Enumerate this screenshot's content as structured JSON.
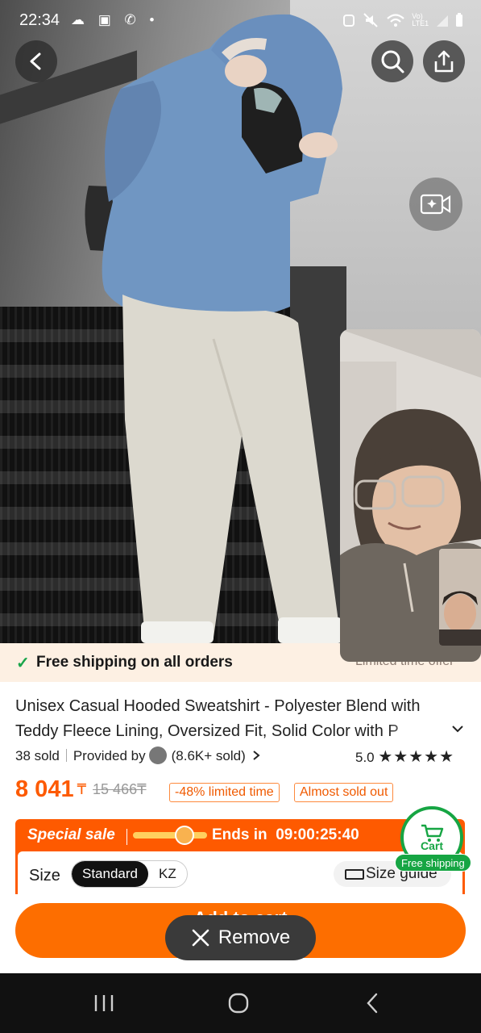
{
  "status_bar": {
    "time": "22:34",
    "left_icons": "☁ ▣ ✆ •",
    "right_icons": "⏰ 🔕 ᯤ Vo) LTE1 ▮",
    "vo_label": "Vo)",
    "lte_label": "LTE1"
  },
  "shipping": {
    "text": "Free shipping on all orders",
    "limited": "Limited time offer"
  },
  "product": {
    "title": "Unisex Casual Hooded Sweatshirt - Polyester Blend with Teddy Fleece Lining, Oversized Fit, Solid Color with P",
    "sold": "38 sold",
    "provided_by": "Provided by",
    "store_sold": "(8.6K+ sold)",
    "rating": "5.0",
    "stars": "★★★★★"
  },
  "price": {
    "current": "8 041",
    "currency": "₸",
    "original": "15 466₸",
    "discount_tag": "-48% limited time",
    "stock_tag": "Almost sold out"
  },
  "sale": {
    "label": "Special sale",
    "ends_label": "Ends in",
    "countdown": "09:00:25:40",
    "progress_fraction": 0.7
  },
  "size": {
    "label": "Size",
    "options": [
      "Standard",
      "KZ"
    ],
    "selected": "Standard",
    "guide": "Size guide"
  },
  "cart": {
    "label": "Cart",
    "badge": "Free shipping"
  },
  "actions": {
    "add_to_cart": "Add to cart",
    "remove": "Remove"
  }
}
